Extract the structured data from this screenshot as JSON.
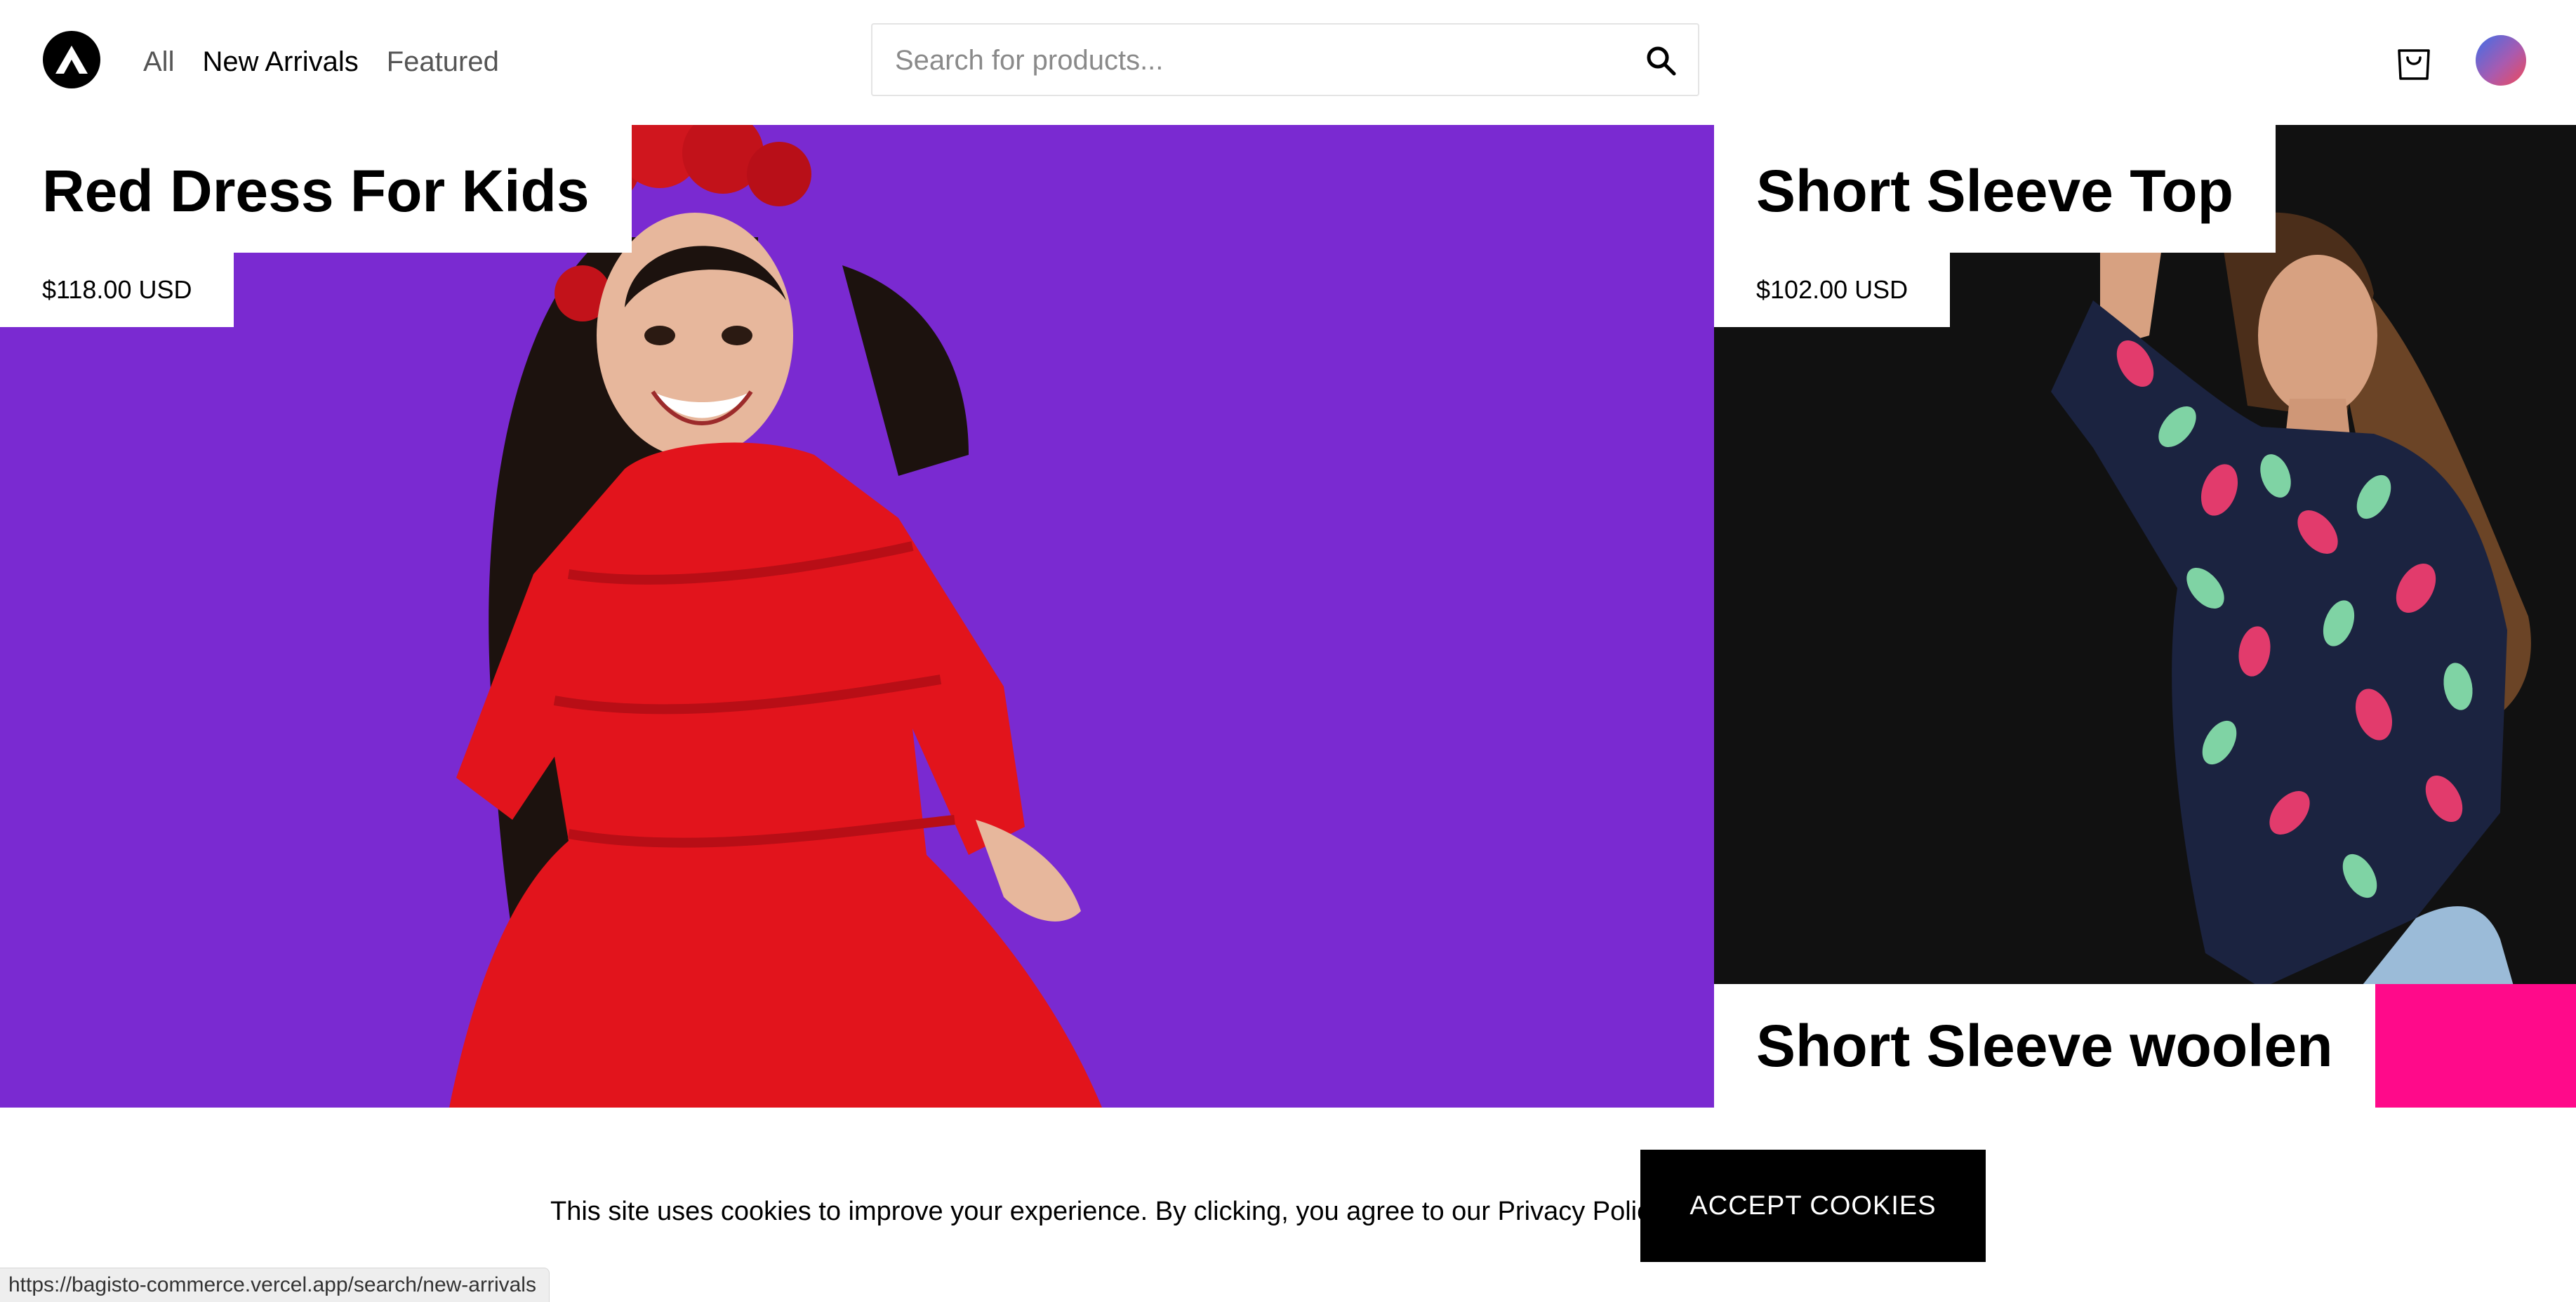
{
  "header": {
    "logo_icon": "brand-logo-icon",
    "nav": [
      {
        "label": "All"
      },
      {
        "label": "New Arrivals"
      },
      {
        "label": "Featured"
      }
    ],
    "search_placeholder": "Search for products...",
    "search_icon": "search-icon",
    "cart_icon": "shopping-bag-icon",
    "avatar_icon": "user-avatar"
  },
  "products": [
    {
      "title": "Red Dress For Kids",
      "price": "$118.00 USD",
      "background": "#7a2ad1"
    },
    {
      "title": "Short Sleeve Top",
      "price": "$102.00 USD",
      "background": "#111111"
    },
    {
      "title": "Short Sleeve woolen",
      "accent": "#ff0a8a"
    }
  ],
  "cookie_banner": {
    "message": "This site uses cookies to improve your experience. By clicking, you agree to our Privacy Policy.",
    "button_label": "ACCEPT COOKIES"
  },
  "status_bar": {
    "url": "https://bagisto-commerce.vercel.app/search/new-arrivals"
  }
}
